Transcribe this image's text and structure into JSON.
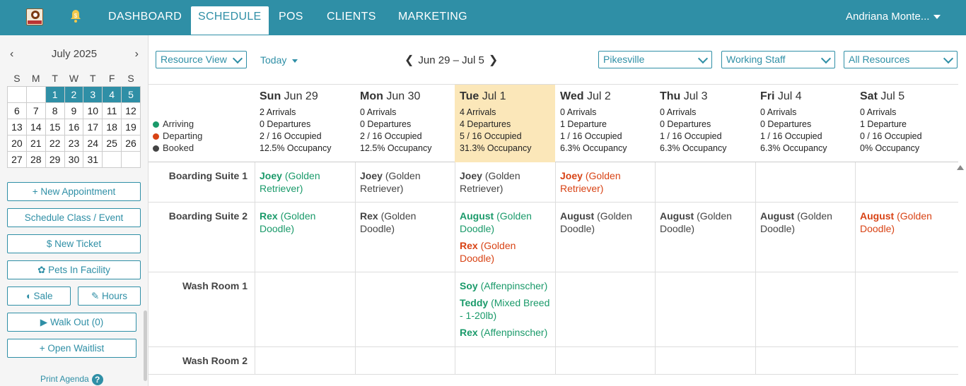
{
  "nav": {
    "items": [
      "DASHBOARD",
      "SCHEDULE",
      "POS",
      "CLIENTS",
      "MARKETING"
    ],
    "active": "SCHEDULE",
    "user": "Andriana Monte...",
    "bell_badge": "$"
  },
  "calendar": {
    "month_label": "July 2025",
    "weekdays": [
      "S",
      "M",
      "T",
      "W",
      "T",
      "F",
      "S"
    ],
    "weeks": [
      [
        "",
        "",
        "1",
        "2",
        "3",
        "4",
        "5"
      ],
      [
        "6",
        "7",
        "8",
        "9",
        "10",
        "11",
        "12"
      ],
      [
        "13",
        "14",
        "15",
        "16",
        "17",
        "18",
        "19"
      ],
      [
        "20",
        "21",
        "22",
        "23",
        "24",
        "25",
        "26"
      ],
      [
        "27",
        "28",
        "29",
        "30",
        "31",
        "",
        ""
      ]
    ]
  },
  "sidebar_buttons": {
    "new_appointment": "+ New Appointment",
    "schedule_class": "Schedule Class / Event",
    "new_ticket": "$  New Ticket",
    "pets_in_facility": "Pets In Facility",
    "sale": "Sale",
    "hours": "Hours",
    "walk_out": "Walk Out (0)",
    "open_waitlist": "+ Open Waitlist",
    "print_agenda": "Print Agenda"
  },
  "toolbar": {
    "view": "Resource View",
    "today": "Today",
    "range": "Jun 29 – Jul 5",
    "location": "Pikesville",
    "staff": "Working Staff",
    "resources": "All Resources"
  },
  "legend": {
    "arriving": "Arriving",
    "departing": "Departing",
    "booked": "Booked"
  },
  "colors": {
    "brand": "#2f8fa6",
    "arriving": "#1a9a6a",
    "departing": "#d84315",
    "booked": "#444444",
    "today_bg": "#fbe7b9"
  },
  "days": [
    {
      "dow": "Sun",
      "date": "Jun 29",
      "arrivals": "2 Arrivals",
      "departures": "0 Departures",
      "occupied": "2 / 16 Occupied",
      "occupancy": "12.5% Occupancy"
    },
    {
      "dow": "Mon",
      "date": "Jun 30",
      "arrivals": "0 Arrivals",
      "departures": "0 Departures",
      "occupied": "2 / 16 Occupied",
      "occupancy": "12.5% Occupancy"
    },
    {
      "dow": "Tue",
      "date": "Jul 1",
      "arrivals": "4 Arrivals",
      "departures": "4 Departures",
      "occupied": "5 / 16 Occupied",
      "occupancy": "31.3% Occupancy"
    },
    {
      "dow": "Wed",
      "date": "Jul 2",
      "arrivals": "0 Arrivals",
      "departures": "1 Departure",
      "occupied": "1 / 16 Occupied",
      "occupancy": "6.3% Occupancy"
    },
    {
      "dow": "Thu",
      "date": "Jul 3",
      "arrivals": "0 Arrivals",
      "departures": "0 Departures",
      "occupied": "1 / 16 Occupied",
      "occupancy": "6.3% Occupancy"
    },
    {
      "dow": "Fri",
      "date": "Jul 4",
      "arrivals": "0 Arrivals",
      "departures": "0 Departures",
      "occupied": "1 / 16 Occupied",
      "occupancy": "6.3% Occupancy"
    },
    {
      "dow": "Sat",
      "date": "Jul 5",
      "arrivals": "0 Arrivals",
      "departures": "1 Departure",
      "occupied": "0 / 16 Occupied",
      "occupancy": "0% Occupancy"
    }
  ],
  "resources": [
    {
      "name": "Boarding Suite 1",
      "cells": [
        [
          {
            "pet": "Joey",
            "breed": "(Golden Retriever)",
            "status": "g"
          }
        ],
        [
          {
            "pet": "Joey",
            "breed": "(Golden Retriever)",
            "status": "k"
          }
        ],
        [
          {
            "pet": "Joey",
            "breed": "(Golden Retriever)",
            "status": "k"
          }
        ],
        [
          {
            "pet": "Joey",
            "breed": "(Golden Retriever)",
            "status": "r"
          }
        ],
        [],
        [],
        []
      ]
    },
    {
      "name": "Boarding Suite 2",
      "cells": [
        [
          {
            "pet": "Rex",
            "breed": "(Golden Doodle)",
            "status": "g"
          }
        ],
        [
          {
            "pet": "Rex",
            "breed": "(Golden Doodle)",
            "status": "k"
          }
        ],
        [
          {
            "pet": "August",
            "breed": "(Golden Doodle)",
            "status": "g"
          },
          {
            "pet": "Rex",
            "breed": "(Golden Doodle)",
            "status": "r"
          }
        ],
        [
          {
            "pet": "August",
            "breed": "(Golden Doodle)",
            "status": "k"
          }
        ],
        [
          {
            "pet": "August",
            "breed": "(Golden Doodle)",
            "status": "k"
          }
        ],
        [
          {
            "pet": "August",
            "breed": "(Golden Doodle)",
            "status": "k"
          }
        ],
        [
          {
            "pet": "August",
            "breed": "(Golden Doodle)",
            "status": "r"
          }
        ]
      ]
    },
    {
      "name": "Wash Room 1",
      "cells": [
        [],
        [],
        [
          {
            "pet": "Soy",
            "breed": "(Affenpinscher)",
            "status": "g"
          },
          {
            "pet": "Teddy",
            "breed": "(Mixed Breed - 1-20lb)",
            "status": "g"
          },
          {
            "pet": "Rex",
            "breed": "(Affenpinscher)",
            "status": "g"
          }
        ],
        [],
        [],
        [],
        []
      ]
    },
    {
      "name": "Wash Room 2",
      "cells": [
        [],
        [],
        [],
        [],
        [],
        [],
        []
      ]
    }
  ]
}
